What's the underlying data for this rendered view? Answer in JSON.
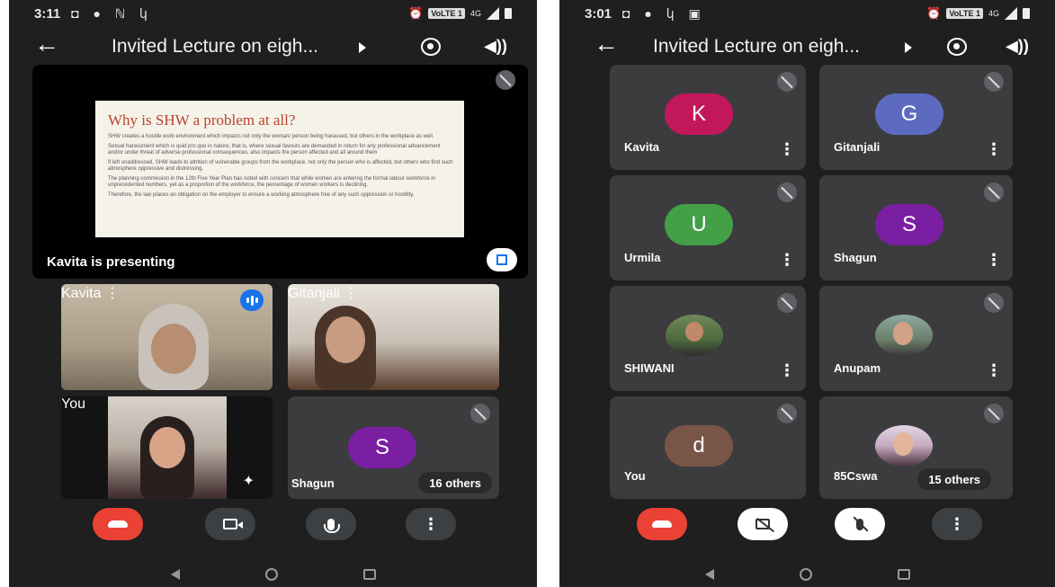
{
  "left": {
    "status": {
      "time": "3:11",
      "icons": "◘ ● ℕ կ",
      "volte": "VoLTE 1",
      "net": "4G"
    },
    "title": "Invited Lecture on eigh...",
    "presentation": {
      "slide_title": "Why is SHW a problem at all?",
      "paragraphs": [
        "SHW creates a hostile work environment which impacts not only the woman/ person being harassed, but others in the workplace as well.",
        "Sexual harassment which is quid pro quo in nature, that is, where sexual favours are demanded in return for any professional advancement and/or under threat of adverse professional consequences, also impacts the person affected and all around them",
        "If left unaddressed, SHW leads to attrition of vulnerable groups from the workplace, not only the person who is affected, but others who find such atmosphere oppressive and distressing.",
        "The planning commission in the 12th Five Year Plan has noted with concern that while women are entering the formal labour workforce in unprecedented numbers, yet as a proportion of the workforce, the percentage of women workers is declining.",
        "Therefore, the law places an obligation on the employer to ensure a working atmosphere free of any such oppression or hostility."
      ],
      "presenting_label": "Kavita is presenting"
    },
    "tiles": {
      "kavita": "Kavita",
      "gitanjali": "Gitanjali",
      "you": "You",
      "shagun": "Shagun",
      "shagun_initial": "S",
      "others": "16 others"
    }
  },
  "right": {
    "status": {
      "time": "3:01",
      "icons": "◘ ● կ ▣",
      "volte": "VoLTE 1",
      "net": "4G"
    },
    "title": "Invited Lecture on eigh...",
    "participants": [
      {
        "name": "Kavita",
        "initial": "K",
        "color": "#c2185b"
      },
      {
        "name": "Gitanjali",
        "initial": "G",
        "color": "#5c6bc0"
      },
      {
        "name": "Urmila",
        "initial": "U",
        "color": "#43a047"
      },
      {
        "name": "Shagun",
        "initial": "S",
        "color": "#7b1fa2"
      },
      {
        "name": "SHIWANI",
        "initial": "",
        "color": ""
      },
      {
        "name": "Anupam",
        "initial": "",
        "color": ""
      },
      {
        "name": "You",
        "initial": "d",
        "color": "#795548"
      },
      {
        "name": "85Cswa",
        "initial": "",
        "color": ""
      }
    ],
    "others": "15 others"
  },
  "colors": {
    "end_call": "#ea4335",
    "tile_bg": "#3c3c3e",
    "app_bg": "#1f1f20",
    "accent": "#1a73e8"
  }
}
